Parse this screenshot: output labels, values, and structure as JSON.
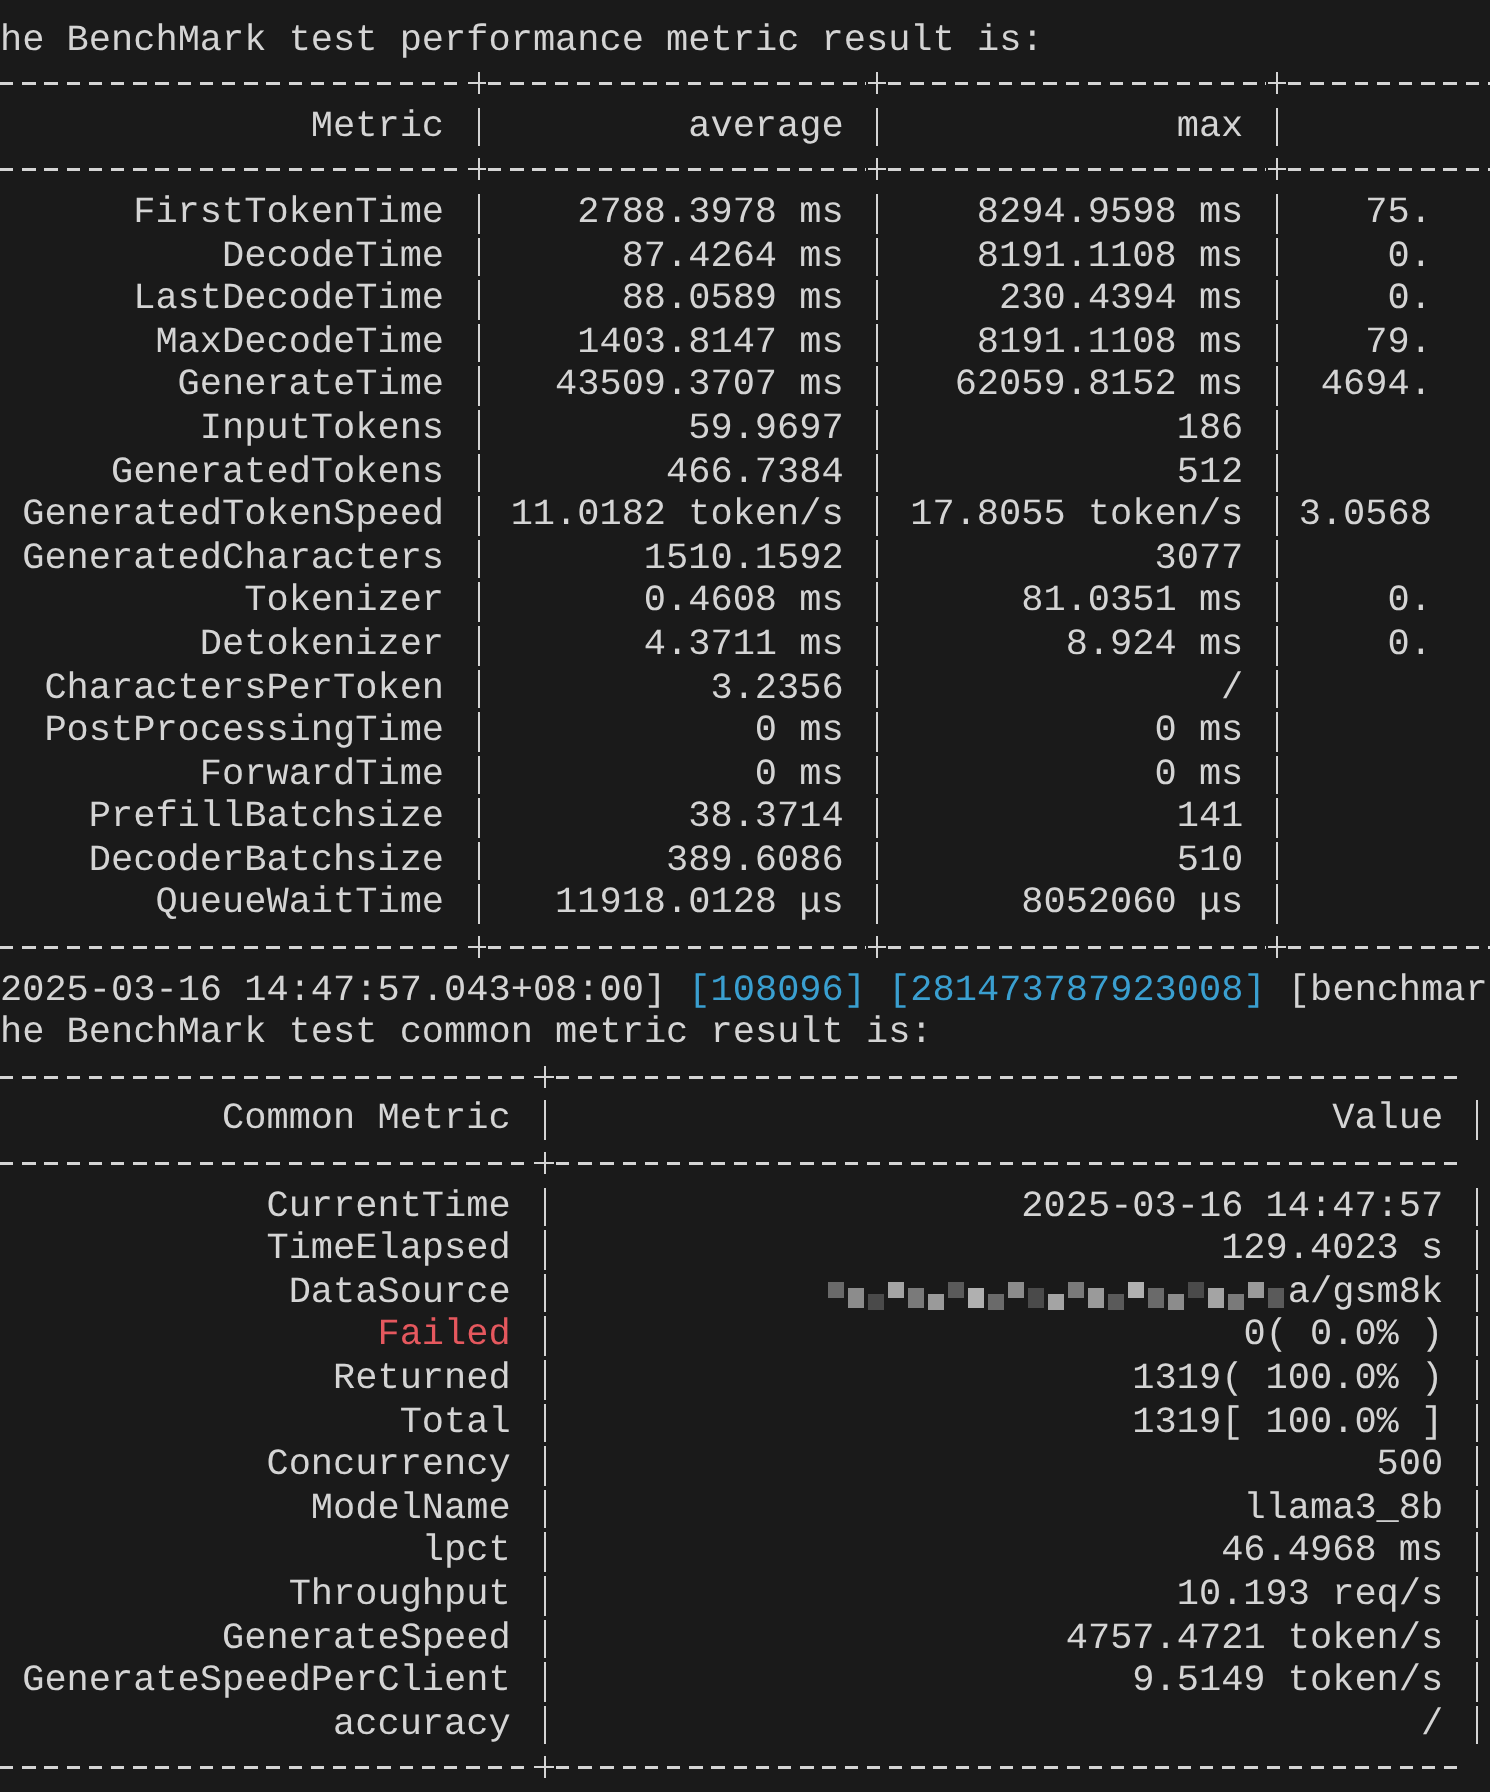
{
  "performance_title": "he BenchMark test performance metric result is:",
  "performance_table": {
    "columns": [
      "Metric",
      "average",
      "max"
    ],
    "rows": [
      {
        "name": "FirstTokenTime",
        "average": "2788.3978 ms",
        "max": "8294.9598 ms",
        "column_4": "75."
      },
      {
        "name": "DecodeTime",
        "average": "87.4264 ms",
        "max": "8191.1108 ms",
        "column_4": "0."
      },
      {
        "name": "LastDecodeTime",
        "average": "88.0589 ms",
        "max": "230.4394 ms",
        "column_4": "0."
      },
      {
        "name": "MaxDecodeTime",
        "average": "1403.8147 ms",
        "max": "8191.1108 ms",
        "column_4": "79."
      },
      {
        "name": "GenerateTime",
        "average": "43509.3707 ms",
        "max": "62059.8152 ms",
        "column_4": "4694."
      },
      {
        "name": "InputTokens",
        "average": "59.9697",
        "max": "186"
      },
      {
        "name": "GeneratedTokens",
        "average": "466.7384",
        "max": "512"
      },
      {
        "name": "GeneratedTokenSpeed",
        "average": "11.0182 token/s",
        "max": "17.8055 token/s",
        "column_4": "3.0568"
      },
      {
        "name": "GeneratedCharacters",
        "average": "1510.1592",
        "max": "3077"
      },
      {
        "name": "Tokenizer",
        "average": "0.4608 ms",
        "max": "81.0351 ms",
        "column_4": "0."
      },
      {
        "name": "Detokenizer",
        "average": "4.3711 ms",
        "max": "8.924 ms",
        "column_4": "0."
      },
      {
        "name": "CharactersPerToken",
        "average": "3.2356",
        "max": "/"
      },
      {
        "name": "PostProcessingTime",
        "average": "0 ms",
        "max": "0 ms"
      },
      {
        "name": "ForwardTime",
        "average": "0 ms",
        "max": "0 ms"
      },
      {
        "name": "PrefillBatchsize",
        "average": "38.3714",
        "max": "141"
      },
      {
        "name": "DecoderBatchsize",
        "average": "389.6086",
        "max": "510"
      },
      {
        "name": "QueueWaitTime",
        "average": "11918.0128 μs",
        "max": "8052060 μs"
      }
    ]
  },
  "log_header_common": [
    {
      "text": "2025-03-16 14:47:57.043+08:00]",
      "kind": "plain"
    },
    {
      "text": "[108096]",
      "kind": "id"
    },
    {
      "text": "[281473787923008]",
      "kind": "id"
    },
    {
      "text": "[benchmar",
      "kind": "plain"
    }
  ],
  "common_title": "he BenchMark test common metric result is:",
  "common_table": {
    "columns": [
      "Common Metric",
      "Value"
    ],
    "rows": [
      {
        "name": "CurrentTime",
        "value": "2025-03-16 14:47:57"
      },
      {
        "name": "TimeElapsed",
        "value": "129.4023 s"
      },
      {
        "name": "DataSource",
        "value": "a/gsm8k",
        "redacted": true
      },
      {
        "name": "Failed",
        "value": "0( 0.0% )",
        "color": "#e5585e"
      },
      {
        "name": "Returned",
        "value": "1319( 100.0% )"
      },
      {
        "name": "Total",
        "value": "1319[ 100.0% ]"
      },
      {
        "name": "Concurrency",
        "value": "500"
      },
      {
        "name": "ModelName",
        "value": "llama3_8b"
      },
      {
        "name": "lpct",
        "value": "46.4968 ms"
      },
      {
        "name": "Throughput",
        "value": "10.193 req/s"
      },
      {
        "name": "GenerateSpeed",
        "value": "4757.4721 token/s"
      },
      {
        "name": "GenerateSpeedPerClient",
        "value": "9.5149 token/s"
      },
      {
        "name": "accuracy",
        "value": "/"
      }
    ]
  }
}
